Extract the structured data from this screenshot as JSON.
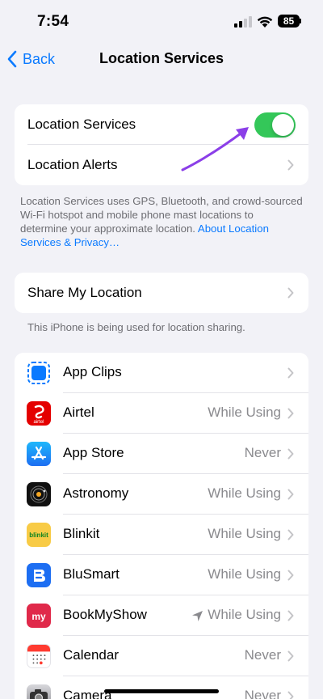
{
  "status_bar": {
    "time": "7:54",
    "battery": "85"
  },
  "nav": {
    "back_label": "Back",
    "title": "Location Services"
  },
  "main_group": {
    "location_services_label": "Location Services",
    "location_services_on": true,
    "location_alerts_label": "Location Alerts"
  },
  "footnote1": {
    "text": "Location Services uses GPS, Bluetooth, and crowd-sourced Wi-Fi hotspot and mobile phone mast locations to determine your approximate location. ",
    "link": "About Location Services & Privacy…"
  },
  "share": {
    "label": "Share My Location"
  },
  "footnote2": "This iPhone is being used for location sharing.",
  "apps": [
    {
      "name": "App Clips",
      "value": "",
      "icon": "app-clips-icon",
      "color": "#ffffff"
    },
    {
      "name": "Airtel",
      "value": "While Using",
      "icon": "airtel-icon",
      "color": "#e40000"
    },
    {
      "name": "App Store",
      "value": "Never",
      "icon": "app-store-icon",
      "color": "#1e8cf8"
    },
    {
      "name": "Astronomy",
      "value": "While Using",
      "icon": "astronomy-icon",
      "color": "#111111"
    },
    {
      "name": "Blinkit",
      "value": "While Using",
      "icon": "blinkit-icon",
      "color": "#f8cb46"
    },
    {
      "name": "BluSmart",
      "value": "While Using",
      "icon": "blusmart-icon",
      "color": "#1d6ef2"
    },
    {
      "name": "BookMyShow",
      "value": "While Using",
      "icon": "bookmyshow-icon",
      "color": "#e0294a",
      "recent_use_arrow": true
    },
    {
      "name": "Calendar",
      "value": "Never",
      "icon": "calendar-icon",
      "color": "#ffffff"
    },
    {
      "name": "Camera",
      "value": "Never",
      "icon": "camera-icon",
      "color": "#6c6c70"
    }
  ],
  "icon_text": {
    "airtel": "airtel",
    "blinkit": "blinkit",
    "bookmyshow": "my"
  },
  "colors": {
    "accent": "#0a7aff",
    "toggle_on": "#34c759",
    "annotation": "#8b3fe8"
  }
}
